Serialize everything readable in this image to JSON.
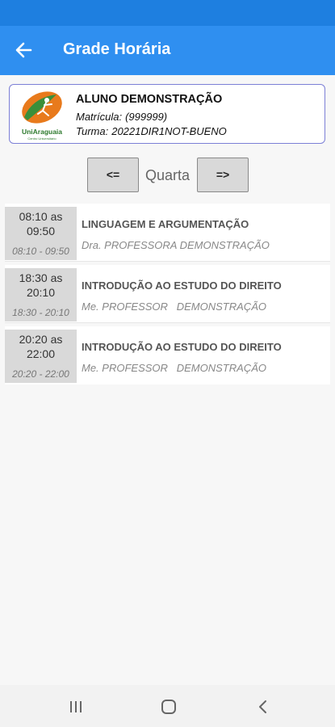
{
  "header": {
    "title": "Grade Horária"
  },
  "student": {
    "name": "ALUNO DEMONSTRAÇÃO",
    "registration_label": "Matrícula:",
    "registration_value": "(999999)",
    "class_label": "Turma:",
    "class_value": "20221DIR1NOT-BUENO",
    "logo_text": "UniAraguaia",
    "logo_subtext": "Centro Universitário"
  },
  "day_nav": {
    "prev_label": "<=",
    "day": "Quarta",
    "next_label": "=>"
  },
  "classes": [
    {
      "start": "08:10 as",
      "end": "09:50",
      "range": "08:10 - 09:50",
      "course": "LINGUAGEM E ARGUMENTAÇÃO",
      "teacher": "Dra. PROFESSORA DEMONSTRAÇÃO"
    },
    {
      "start": "18:30 as",
      "end": "20:10",
      "range": "18:30 - 20:10",
      "course": "INTRODUÇÃO AO ESTUDO DO DIREITO",
      "teacher": "Me. PROFESSOR   DEMONSTRAÇÃO"
    },
    {
      "start": "20:20 as",
      "end": "22:00",
      "range": "20:20 - 22:00",
      "course": "INTRODUÇÃO AO ESTUDO DO DIREITO",
      "teacher": "Me. PROFESSOR   DEMONSTRAÇÃO"
    }
  ],
  "colors": {
    "app_bar": "#2f8ff0",
    "status_bar": "#1e7fe0",
    "card_border": "#7c7fd6",
    "time_box": "#d9d9d9"
  }
}
